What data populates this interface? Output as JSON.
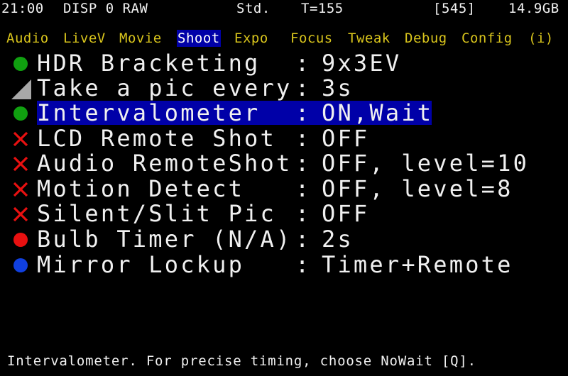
{
  "status_bar": {
    "time": "21:00",
    "display": "DISP 0 RAW",
    "picture_style": "Std.",
    "temperature": "T=155",
    "shots_remaining": "[545]",
    "card_space": "14.9GB"
  },
  "tabs": [
    {
      "label": "Audio",
      "active": false
    },
    {
      "label": "LiveV",
      "active": false
    },
    {
      "label": "Movie",
      "active": false
    },
    {
      "label": "Shoot",
      "active": true
    },
    {
      "label": "Expo",
      "active": false
    },
    {
      "label": "Focus",
      "active": false
    },
    {
      "label": "Tweak",
      "active": false
    },
    {
      "label": "Debug",
      "active": false
    },
    {
      "label": "Config",
      "active": false
    },
    {
      "label": "(i)",
      "active": false
    }
  ],
  "colors": {
    "tab_text": "#d8c41c",
    "selection_bg": "#0000a8",
    "on_green": "#10a010",
    "off_red": "#e81010",
    "na_red": "#e81010",
    "info_blue": "#1040e0",
    "partial_gray": "#a8a8a8"
  },
  "menu": {
    "items": [
      {
        "name": "HDR Bracketing",
        "separator": ":",
        "value": "9x3EV",
        "status_icon": "green-dot-icon",
        "selected": false
      },
      {
        "name": "Take a pic every",
        "separator": ":",
        "value": "3s",
        "status_icon": "gray-triangle-icon",
        "selected": false
      },
      {
        "name": "Intervalometer",
        "separator": ":",
        "value": "ON,Wait",
        "status_icon": "green-dot-icon",
        "selected": true
      },
      {
        "name": "LCD Remote Shot",
        "separator": ":",
        "value": "OFF",
        "status_icon": "red-x-icon",
        "selected": false
      },
      {
        "name": "Audio RemoteShot",
        "separator": ":",
        "value": "OFF, level=10",
        "status_icon": "red-x-icon",
        "selected": false
      },
      {
        "name": "Motion Detect",
        "separator": ":",
        "value": "OFF, level=8",
        "status_icon": "red-x-icon",
        "selected": false
      },
      {
        "name": "Silent/Slit Pic",
        "separator": ":",
        "value": "OFF",
        "status_icon": "red-x-icon",
        "selected": false
      },
      {
        "name": "Bulb Timer (N/A)",
        "separator": ":",
        "value": "2s",
        "status_icon": "red-dot-icon",
        "selected": false
      },
      {
        "name": "Mirror Lockup",
        "separator": ":",
        "value": "Timer+Remote",
        "status_icon": "blue-dot-icon",
        "selected": false
      }
    ]
  },
  "help_text": "Intervalometer. For precise timing, choose NoWait [Q]."
}
